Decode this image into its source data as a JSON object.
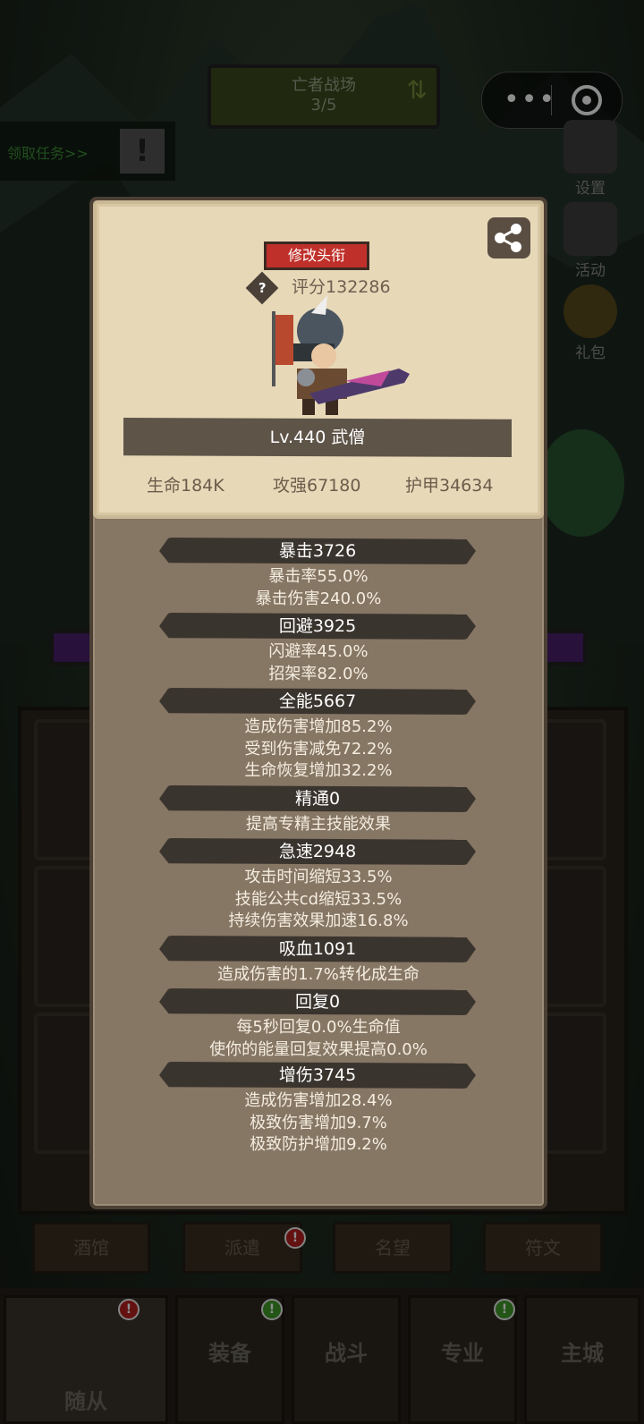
{
  "top_bar": {
    "stage_title": "亡者战场",
    "stage_progress": "3/5"
  },
  "quest": {
    "label": "领取任务>>"
  },
  "side_menu": [
    {
      "label": "设置"
    },
    {
      "label": "活动"
    },
    {
      "label": "礼包"
    }
  ],
  "panel": {
    "title_button": "修改头衔",
    "score": "评分132286",
    "score_help": "?",
    "name_line": "Lv.440 武僧",
    "main_stats": [
      "生命184K",
      "攻强67180",
      "护甲34634"
    ],
    "stats": [
      {
        "title": "暴击3726",
        "lines": [
          "暴击率55.0%",
          "暴击伤害240.0%"
        ]
      },
      {
        "title": "回避3925",
        "lines": [
          "闪避率45.0%",
          "招架率82.0%"
        ]
      },
      {
        "title": "全能5667",
        "lines": [
          "造成伤害增加85.2%",
          "受到伤害减免72.2%",
          "生命恢复增加32.2%"
        ]
      },
      {
        "title": "精通0",
        "lines": [
          "提高专精主技能效果"
        ]
      },
      {
        "title": "急速2948",
        "lines": [
          "攻击时间缩短33.5%",
          "技能公共cd缩短33.5%",
          "持续伤害效果加速16.8%"
        ]
      },
      {
        "title": "吸血1091",
        "lines": [
          "造成伤害的1.7%转化成生命"
        ]
      },
      {
        "title": "回复0",
        "lines": [
          "每5秒回复0.0%生命值",
          "使你的能量回复效果提高0.0%"
        ]
      },
      {
        "title": "增伤3745",
        "lines": [
          "造成伤害增加28.4%",
          "极致伤害增加9.7%",
          "极致防护增加9.2%"
        ]
      }
    ]
  },
  "sub_tabs": [
    "酒馆",
    "派遣",
    "名望",
    "符文"
  ],
  "bottom_tabs": [
    "随从",
    "装备",
    "战斗",
    "专业",
    "主城"
  ],
  "badge": "!"
}
